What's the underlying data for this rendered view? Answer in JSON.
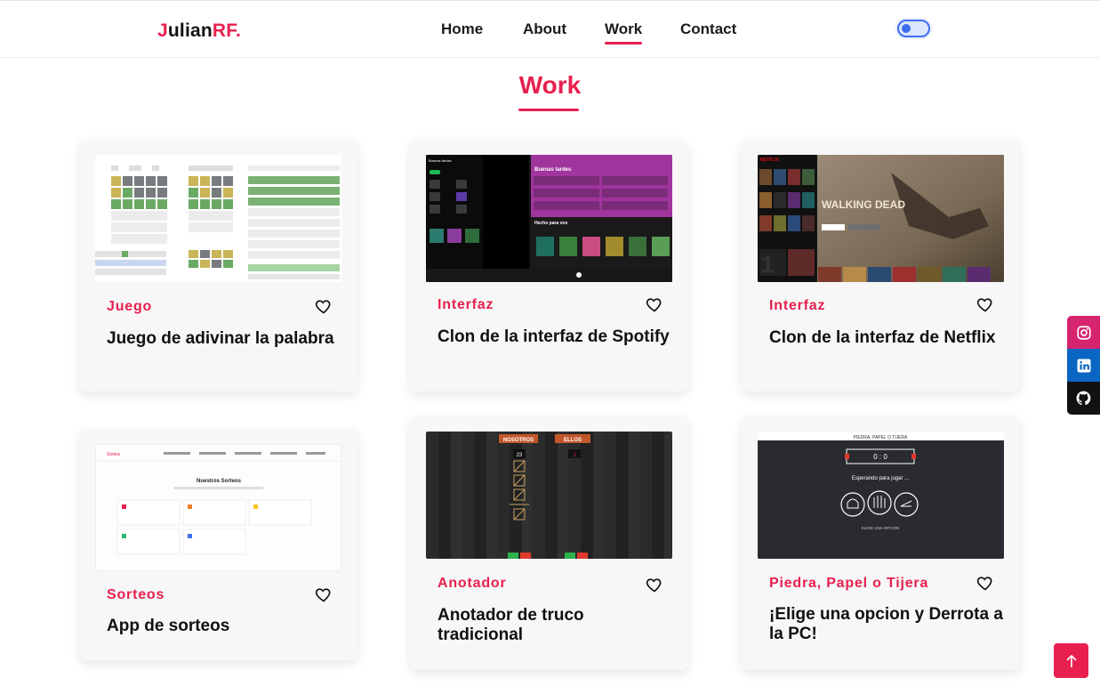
{
  "header": {
    "logo_j": "J",
    "logo_text": "ulian",
    "logo_rf": "RF",
    "logo_dot": ".",
    "nav": [
      {
        "label": "Home"
      },
      {
        "label": "About"
      },
      {
        "label": "Work"
      },
      {
        "label": "Contact"
      }
    ]
  },
  "section": {
    "title": "Work"
  },
  "cards": [
    {
      "category": "Juego",
      "title": "Juego de adivinar la palabra",
      "thumb": "wordle-screenshot"
    },
    {
      "category": "Interfaz",
      "title": "Clon de la interfaz de Spotify",
      "thumb": "spotify-screenshot"
    },
    {
      "category": "Interfaz",
      "title": "Clon de la interfaz de Netflix",
      "thumb": "netflix-screenshot"
    },
    {
      "category": "Sorteos",
      "title": "App de sorteos",
      "thumb": "sorteos-screenshot"
    },
    {
      "category": "Anotador",
      "title": "Anotador de truco tradicional",
      "thumb": "truco-screenshot"
    },
    {
      "category": "Piedra, Papel o Tijera",
      "title": "¡Elige una opcion y Derrota a la PC!",
      "thumb": "ppt-screenshot"
    }
  ],
  "thumb_text": {
    "spotify_heading": "Buenas tardes",
    "spotify_subheading": "Hecho para vos",
    "netflix_hero": "WALKING DEAD",
    "sorteos_heading": "Nuestros Sorteos",
    "sorteos_logo": "Sortea",
    "truco_left": "NOSOTROS",
    "truco_right": "ELLOS",
    "truco_score_left": "23",
    "truco_score_right": "1",
    "ppt_header": "PIEDRA, PAPEL O TIJERA",
    "ppt_score": "0 : 0",
    "ppt_status": "Esperando para jugar ...",
    "ppt_footer": "ELIGE UNA OPCIÓN"
  },
  "colors": {
    "accent": "#e8204f",
    "instagram": "#d6246e",
    "linkedin": "#0a66c2",
    "github": "#111111",
    "toggle": "#3f6ff0"
  },
  "icons": {
    "social": [
      "instagram-icon",
      "linkedin-icon",
      "github-icon"
    ],
    "favorite": "heart-icon",
    "scroll_top": "arrow-up-icon",
    "theme_toggle": "toggle-switch"
  }
}
